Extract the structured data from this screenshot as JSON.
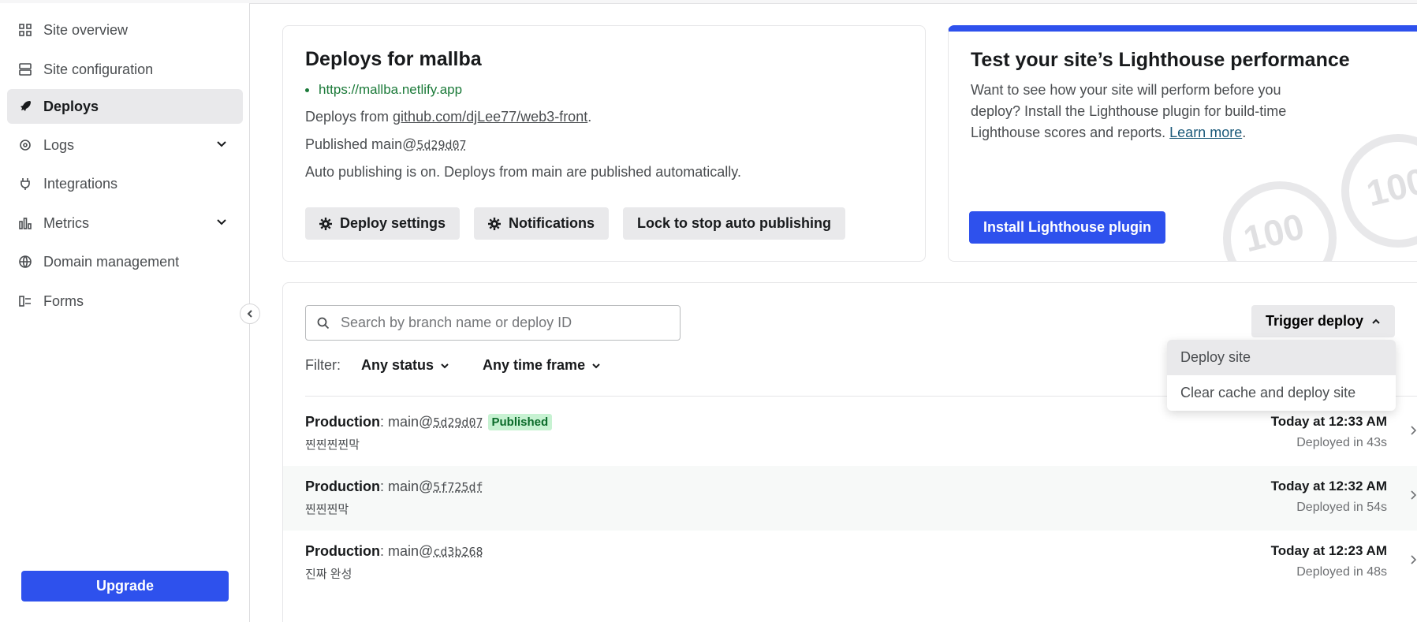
{
  "sidebar": {
    "items": [
      {
        "label": "Site overview",
        "icon": "grid-icon"
      },
      {
        "label": "Site configuration",
        "icon": "config-icon"
      },
      {
        "label": "Deploys",
        "icon": "rocket-icon",
        "active": true
      },
      {
        "label": "Logs",
        "icon": "logs-icon",
        "expandable": true
      },
      {
        "label": "Integrations",
        "icon": "plug-icon"
      },
      {
        "label": "Metrics",
        "icon": "chart-icon",
        "expandable": true
      },
      {
        "label": "Domain management",
        "icon": "globe-icon"
      },
      {
        "label": "Forms",
        "icon": "forms-icon"
      }
    ],
    "upgrade_label": "Upgrade"
  },
  "deploys_card": {
    "title": "Deploys for mallba",
    "site_url": "https://mallba.netlify.app",
    "deploys_from_prefix": "Deploys from ",
    "repo": "github.com/djLee77/web3-front",
    "repo_suffix": ".",
    "published_prefix": "Published main@",
    "published_commit": "5d29d07",
    "auto_publishing": "Auto publishing is on. Deploys from main are published automatically.",
    "buttons": {
      "deploy_settings": "Deploy settings",
      "notifications": "Notifications",
      "lock": "Lock to stop auto publishing"
    }
  },
  "lighthouse_card": {
    "title": "Test your site’s Lighthouse performance",
    "text": "Want to see how your site will perform before you deploy? Install the Lighthouse plugin for build-time Lighthouse scores and reports. ",
    "learn_more": "Learn more",
    "text_suffix": ".",
    "button": "Install Lighthouse plugin",
    "badge_text": "100",
    "accent_color": "#2e51ed"
  },
  "deploy_list": {
    "search_placeholder": "Search by branch name or deploy ID",
    "filter_label": "Filter:",
    "status_filter": "Any status",
    "time_filter": "Any time frame",
    "trigger_label": "Trigger deploy",
    "trigger_options": [
      "Deploy site",
      "Clear cache and deploy site"
    ],
    "rows": [
      {
        "context": "Production",
        "branch": ": main@",
        "commit": "5d29d07",
        "badge": "Published",
        "message": "찐찐찐찐막",
        "time": "Today at 12:33 AM",
        "duration": "Deployed in 43s"
      },
      {
        "context": "Production",
        "branch": ": main@",
        "commit": "5f725df",
        "badge": "",
        "message": "찐찐찐막",
        "time": "Today at 12:32 AM",
        "duration": "Deployed in 54s"
      },
      {
        "context": "Production",
        "branch": ": main@",
        "commit": "cd3b268",
        "badge": "",
        "message": "진짜 완성",
        "time": "Today at 12:23 AM",
        "duration": "Deployed in 48s"
      }
    ]
  }
}
